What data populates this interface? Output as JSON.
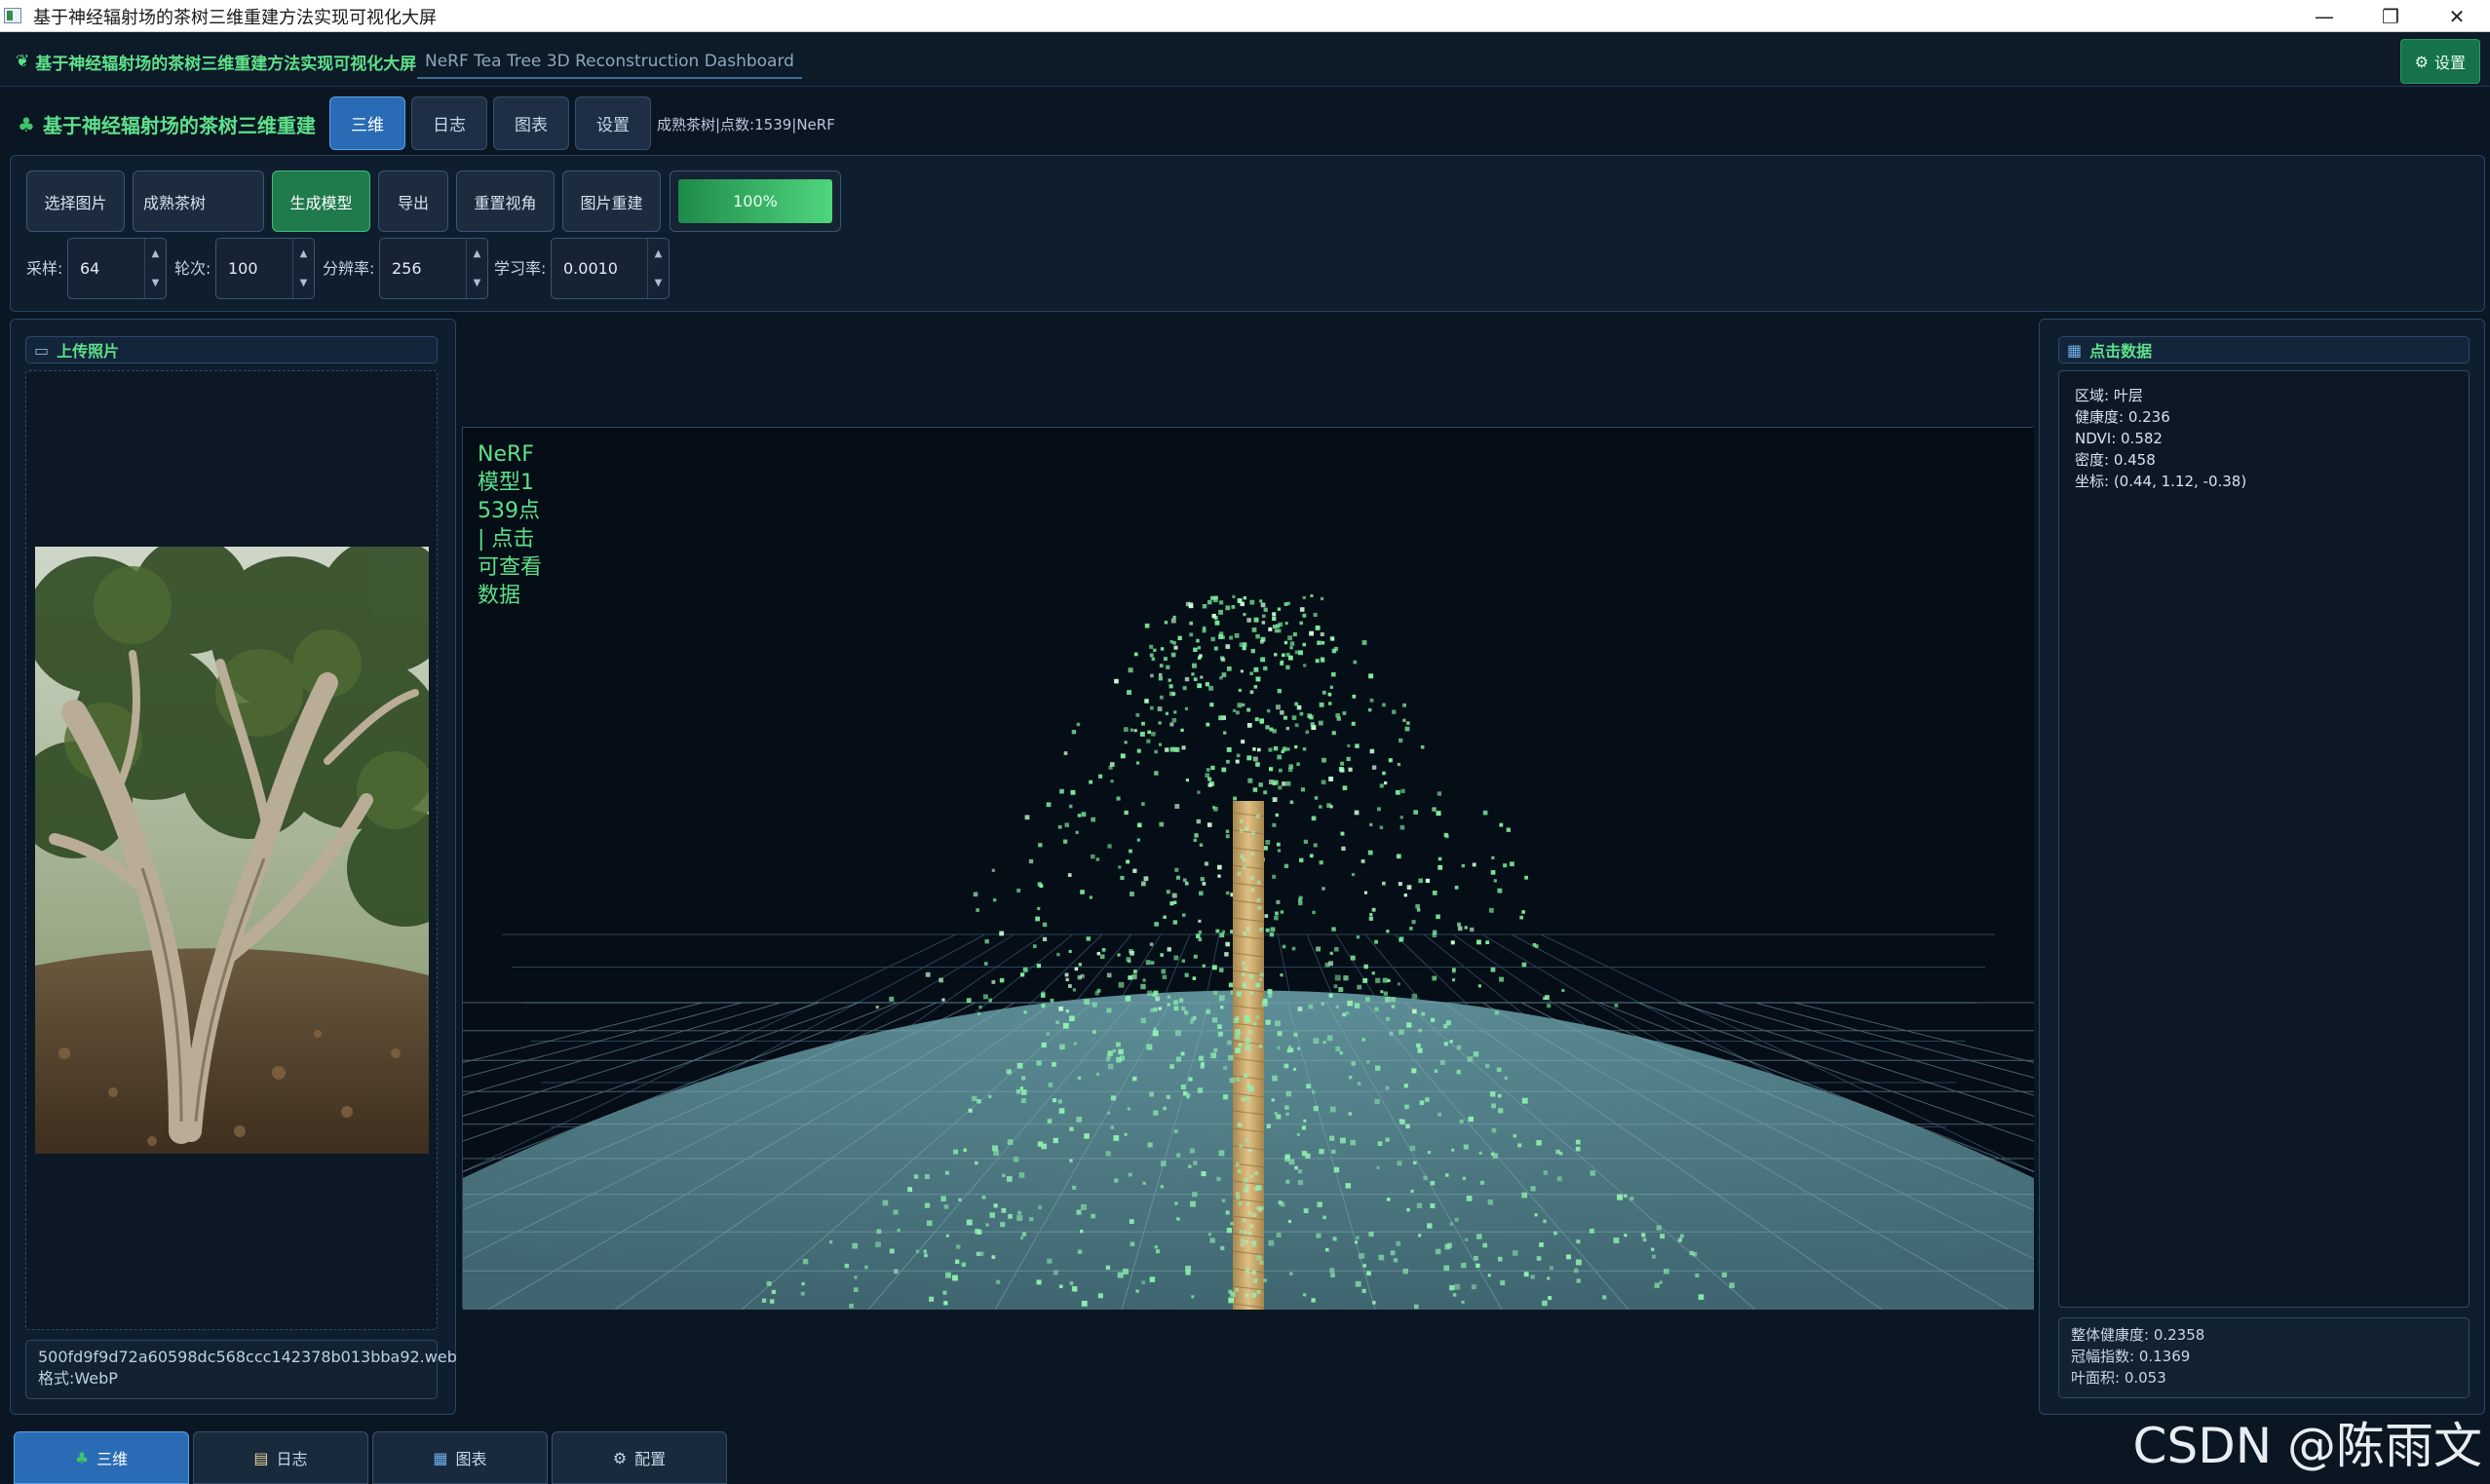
{
  "window": {
    "title": "基于神经辐射场的茶树三维重建方法实现可视化大屏",
    "minimize": "—",
    "restore": "❐",
    "close": "✕"
  },
  "appbar": {
    "tab_active": "基于神经辐射场的茶树三维重建方法实现可视化大屏",
    "tab_secondary": "NeRF Tea Tree 3D Reconstruction Dashboard",
    "settings_label": "设置"
  },
  "header": {
    "brand": "基于神经辐射场的茶树三维重建",
    "nav": [
      "三维",
      "日志",
      "图表",
      "设置"
    ],
    "status": "成熟茶树|点数:1539|NeRF"
  },
  "toolbar": {
    "select_image": "选择图片",
    "tree_type": "成熟茶树",
    "generate_model": "生成模型",
    "export": "导出",
    "reset_view": "重置视角",
    "image_reconstruct": "图片重建",
    "progress_label": "100%",
    "progress_value": 1.0,
    "params": {
      "samples_label": "采样:",
      "samples_value": "64",
      "epochs_label": "轮次:",
      "epochs_value": "100",
      "resolution_label": "分辨率:",
      "resolution_value": "256",
      "lr_label": "学习率:",
      "lr_value": "0.0010"
    }
  },
  "upload": {
    "title": "上传照片",
    "filename": "500fd9f9d72a60598dc568ccc142378b013bba92.web",
    "format": "格式:WebP"
  },
  "viewport": {
    "overlay_text": "NeRF模型1539点 | 点击可查看数据",
    "point_count": 1539
  },
  "point_data": {
    "title": "点击数据",
    "lines": [
      "区域: 叶层",
      "健康度: 0.236",
      "NDVI: 0.582",
      "密度: 0.458",
      "坐标: (0.44, 1.12, -0.38)"
    ],
    "summary": [
      "整体健康度: 0.2358",
      "冠幅指数: 0.1369",
      "叶面积: 0.053"
    ]
  },
  "bottom_tabs": [
    "三维",
    "日志",
    "图表",
    "配置"
  ],
  "watermark": "CSDN @陈雨文",
  "colors": {
    "accent_green": "#5ee08a",
    "nav_active": "#2a6bb5",
    "background": "#0b1623",
    "ground": "#4e7c86",
    "trunk": "#c9a66b"
  }
}
